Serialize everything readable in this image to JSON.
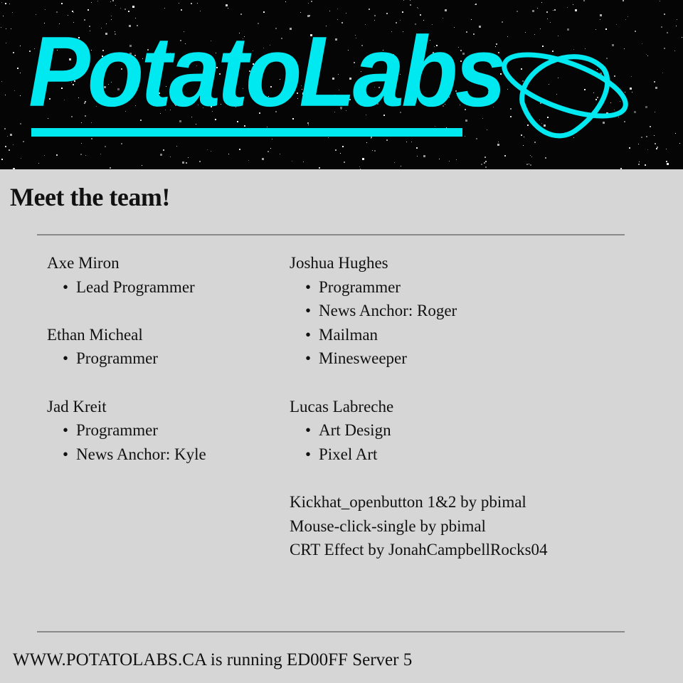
{
  "header": {
    "logo_text": "PotatoLabs",
    "logo_icon": "planet-icon",
    "accent_color": "#00e8f0"
  },
  "page": {
    "title": "Meet the team!"
  },
  "team": {
    "left": [
      {
        "name": "Axe Miron",
        "roles": [
          "Lead Programmer"
        ]
      },
      {
        "name": "Ethan Micheal",
        "roles": [
          "Programmer"
        ]
      },
      {
        "name": "Jad Kreit",
        "roles": [
          "Programmer",
          "News Anchor: Kyle"
        ]
      }
    ],
    "right": [
      {
        "name": "Joshua Hughes",
        "roles": [
          "Programmer",
          "News Anchor: Roger",
          "Mailman",
          "Minesweeper"
        ]
      },
      {
        "name": "Lucas Labreche",
        "roles": [
          "Art Design",
          "Pixel Art"
        ]
      }
    ]
  },
  "credits": [
    "Kickhat_openbutton 1&2 by pbimal",
    "Mouse-click-single by pbimal",
    "CRT Effect by JonahCampbellRocks04"
  ],
  "footer": {
    "text": "WWW.POTATOLABS.CA is running ED00FF Server 5"
  }
}
